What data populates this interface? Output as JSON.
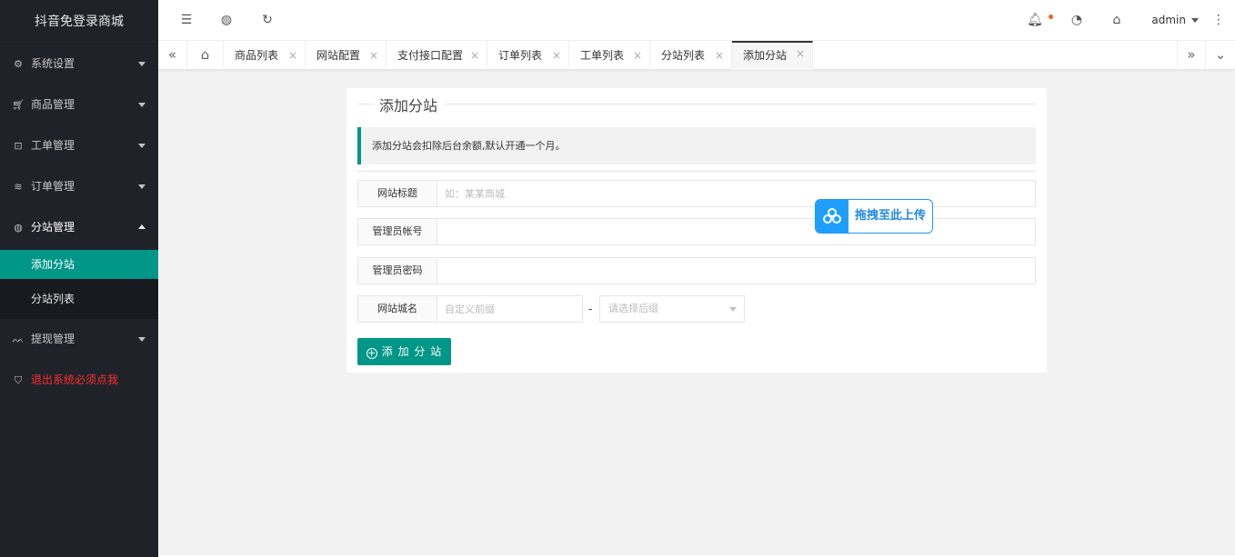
{
  "app": {
    "title": "抖音免登录商城"
  },
  "sidebar": {
    "items": [
      {
        "label": "系统设置",
        "icon": "gear-icon"
      },
      {
        "label": "商品管理",
        "icon": "cart-icon"
      },
      {
        "label": "工单管理",
        "icon": "ticket-icon"
      },
      {
        "label": "订单管理",
        "icon": "layers-icon"
      },
      {
        "label": "分站管理",
        "icon": "globe-icon"
      },
      {
        "label": "提现管理",
        "icon": "pulse-icon"
      },
      {
        "label": "退出系统必须点我",
        "icon": "shield-icon"
      }
    ],
    "subitems": [
      {
        "label": "添加分站"
      },
      {
        "label": "分站列表"
      }
    ]
  },
  "header": {
    "user": "admin"
  },
  "tabs": [
    {
      "label": "商品列表",
      "close": "×"
    },
    {
      "label": "网站配置",
      "close": "×"
    },
    {
      "label": "支付接口配置",
      "close": "×"
    },
    {
      "label": "订单列表",
      "close": "×"
    },
    {
      "label": "工单列表",
      "close": "×"
    },
    {
      "label": "分站列表",
      "close": "×"
    },
    {
      "label": "添加分站",
      "close": "×"
    }
  ],
  "form": {
    "legend": "添加分站",
    "notice": "添加分站会扣除后台余额,默认开通一个月。",
    "site_title": {
      "label": "网站标题",
      "placeholder": "如：某某商城",
      "value": ""
    },
    "admin_account": {
      "label": "管理员帐号",
      "value": ""
    },
    "admin_password": {
      "label": "管理员密码",
      "value": ""
    },
    "domain": {
      "label": "网站城名",
      "prefix_placeholder": "自定义前缀",
      "separator": "-",
      "suffix_placeholder": "请选择后缀"
    },
    "submit": "添 加 分 站"
  },
  "upload": {
    "label": "拖拽至此上传"
  },
  "colors": {
    "accent": "#009688",
    "sidebar_bg": "#20222a",
    "danger": "#ff2d2d",
    "upload_blue": "#1e9fff"
  }
}
